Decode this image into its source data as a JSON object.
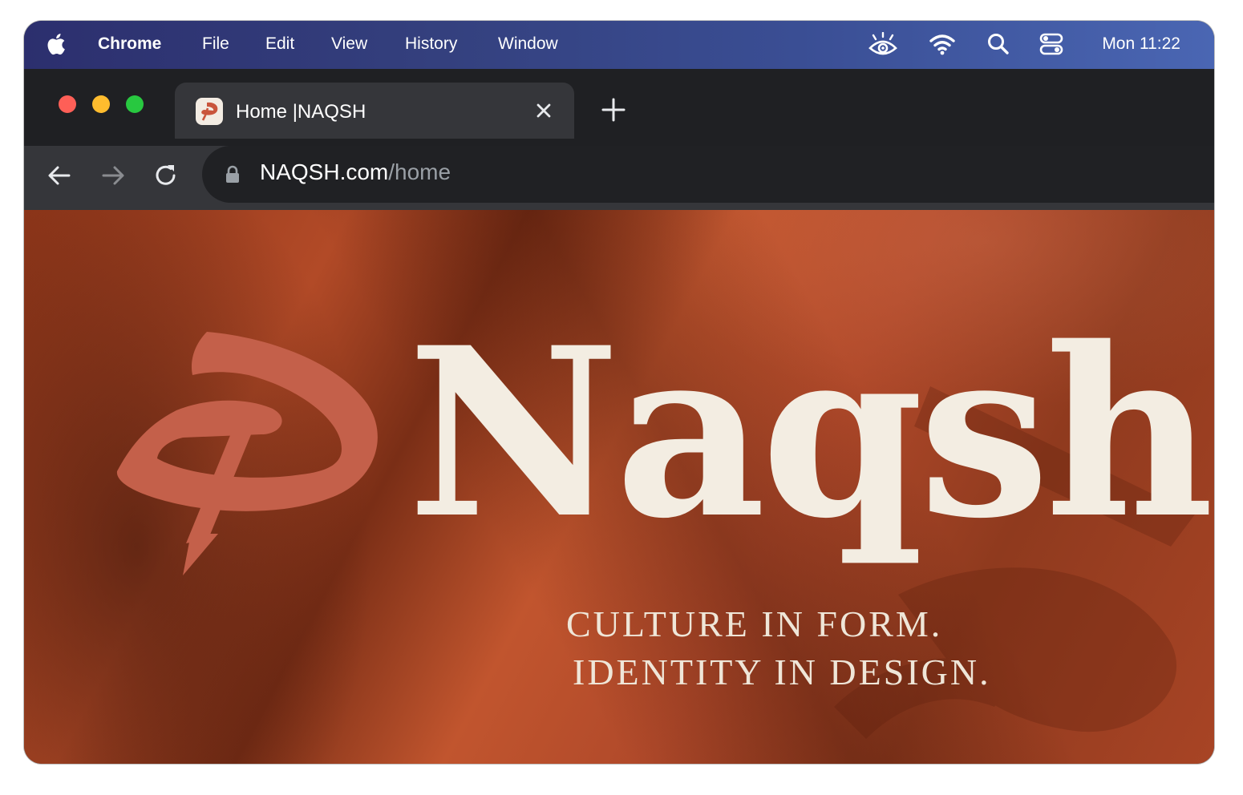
{
  "menubar": {
    "app_name": "Chrome",
    "menus": [
      "File",
      "Edit",
      "View",
      "History",
      "Window"
    ],
    "status_icons": [
      "eye-icon",
      "wifi-icon",
      "search-icon",
      "control-center-icon"
    ],
    "clock": "Mon 11:22"
  },
  "colors": {
    "menubar_start": "#2c2f6e",
    "menubar_end": "#4a66b3",
    "browser_frame": "#1f2023",
    "tab_active": "#35363a",
    "hero_terracotta": "#b24a27",
    "brand_mark": "#c45e44",
    "brand_cream": "#f3ede2"
  },
  "browser": {
    "tab": {
      "title": "Home |NAQSH",
      "favicon": "naqsh-logo-icon"
    },
    "address": {
      "domain": "NAQSH.com",
      "path": "/home"
    }
  },
  "page": {
    "brand_name": "Naqsh",
    "tagline_line1": "CULTURE IN FORM.",
    "tagline_line2": "IDENTITY IN DESIGN."
  }
}
